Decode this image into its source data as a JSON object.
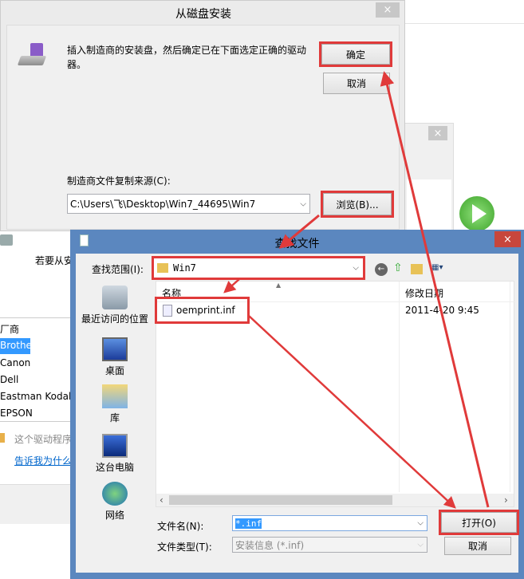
{
  "background_window": {
    "left_text": "若要从安",
    "list_header": "厂商",
    "manufacturers": [
      "Brother",
      "Canon",
      "Dell",
      "Eastman Kodak",
      "EPSON"
    ],
    "selected": "Brother",
    "notice": "这个驱动程序",
    "link": "告诉我为什么"
  },
  "disk_dialog": {
    "title": "从磁盘安装",
    "message": "插入制造商的安装盘，然后确定已在下面选定正确的驱动器。",
    "ok": "确定",
    "cancel": "取消",
    "source_label": "制造商文件复制来源(C):",
    "source_value": "C:\\Users\\飞\\Desktop\\Win7_44695\\Win7",
    "browse": "浏览(B)...",
    "close": "×"
  },
  "file_dialog": {
    "title": "查找文件",
    "look_in_label": "查找范围(I):",
    "look_in_value": "Win7",
    "places": [
      "最近访问的位置",
      "桌面",
      "库",
      "这台电脑",
      "网络"
    ],
    "columns": [
      "名称",
      "修改日期"
    ],
    "files": [
      {
        "name": "oemprint.inf",
        "modified": "2011-4-20 9:45"
      }
    ],
    "filename_label": "文件名(N):",
    "filename_value": "*.inf",
    "filetype_label": "文件类型(T):",
    "filetype_value": "安装信息 (*.inf)",
    "open": "打开(O)",
    "cancel": "取消",
    "close": "×"
  },
  "colors": {
    "annotation": "#e03a3a",
    "titlebar": "#5b87bf",
    "selection": "#3399ff"
  }
}
